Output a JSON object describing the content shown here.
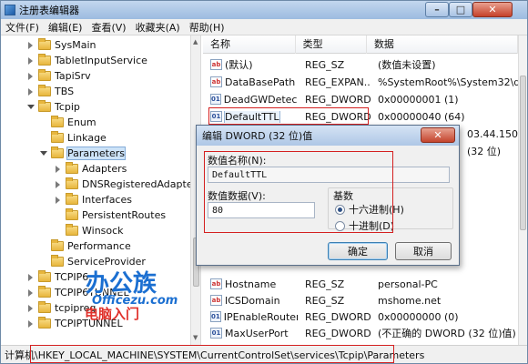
{
  "window": {
    "title": "注册表编辑器",
    "minimize_symbol": "–",
    "maximize_symbol": "□",
    "close_symbol": "✕"
  },
  "menu": [
    "文件(F)",
    "编辑(E)",
    "查看(V)",
    "收藏夹(A)",
    "帮助(H)"
  ],
  "tree": {
    "items": [
      {
        "label": "SysMain",
        "expanded": false
      },
      {
        "label": "TabletInputService",
        "expanded": false
      },
      {
        "label": "TapiSrv",
        "expanded": false
      },
      {
        "label": "TBS",
        "expanded": false
      },
      {
        "label": "Tcpip",
        "expanded": true
      },
      {
        "label": "Enum",
        "expanded": false
      },
      {
        "label": "Linkage",
        "expanded": false
      },
      {
        "label": "Parameters",
        "expanded": true,
        "selected": true
      },
      {
        "label": "Adapters",
        "expanded": false
      },
      {
        "label": "DNSRegisteredAdapters",
        "expanded": false
      },
      {
        "label": "Interfaces",
        "expanded": false
      },
      {
        "label": "PersistentRoutes",
        "expanded": false
      },
      {
        "label": "Winsock",
        "expanded": false
      },
      {
        "label": "Performance",
        "expanded": false
      },
      {
        "label": "ServiceProvider",
        "expanded": false
      },
      {
        "label": "TCPIP6",
        "expanded": false
      },
      {
        "label": "TCPIP6TUNNEL",
        "expanded": false
      },
      {
        "label": "tcpipreg",
        "expanded": false
      },
      {
        "label": "TCPIPTUNNEL",
        "expanded": false
      }
    ]
  },
  "values": {
    "headers": [
      "名称",
      "类型",
      "数据"
    ],
    "rows": [
      {
        "name": "(默认)",
        "type": "REG_SZ",
        "data": "(数值未设置)",
        "icon": "string-value-icon"
      },
      {
        "name": "DataBasePath",
        "type": "REG_EXPAN...",
        "data": "%SystemRoot%\\System32\\dri",
        "icon": "string-value-icon"
      },
      {
        "name": "DeadGWDetec...",
        "type": "REG_DWORD",
        "data": "0x00000001 (1)",
        "icon": "dword-value-icon"
      },
      {
        "name": "DefaultTTL",
        "type": "REG_DWORD",
        "data": "0x00000040 (64)",
        "icon": "dword-value-icon",
        "selected": true
      },
      {
        "name": "",
        "type": "",
        "data": "03.44.150",
        "icon": ""
      },
      {
        "name": "",
        "type": "",
        "data": "(32 位)",
        "icon": ""
      },
      {
        "name": "Hostname",
        "type": "REG_SZ",
        "data": "personal-PC",
        "icon": "string-value-icon"
      },
      {
        "name": "ICSDomain",
        "type": "REG_SZ",
        "data": "mshome.net",
        "icon": "string-value-icon"
      },
      {
        "name": "IPEnableRouter",
        "type": "REG_DWORD",
        "data": "0x00000000 (0)",
        "icon": "dword-value-icon"
      },
      {
        "name": "MaxUserPort",
        "type": "REG_DWORD",
        "data": "(不正确的 DWORD (32 位)值)",
        "icon": "dword-value-icon"
      }
    ]
  },
  "statusbar": {
    "path": "计算机\\HKEY_LOCAL_MACHINE\\SYSTEM\\CurrentControlSet\\services\\Tcpip\\Parameters"
  },
  "dialog": {
    "title": "编辑 DWORD (32 位)值",
    "close_symbol": "✕",
    "name_label": "数值名称(N):",
    "name_value": "DefaultTTL",
    "data_label": "数值数据(V):",
    "data_value": "80",
    "base_label": "基数",
    "base_options": [
      {
        "label": "十六进制(H)",
        "checked": true
      },
      {
        "label": "十进制(D)",
        "checked": false
      }
    ],
    "ok_label": "确定",
    "cancel_label": "取消"
  },
  "watermark": {
    "line1": "办公族",
    "line2": "Officezu.com",
    "line3": "电脑入门"
  },
  "colors": {
    "highlight_box": "#d42020",
    "watermark_blue": "#1b6fd1",
    "watermark_red": "#e0322c"
  }
}
